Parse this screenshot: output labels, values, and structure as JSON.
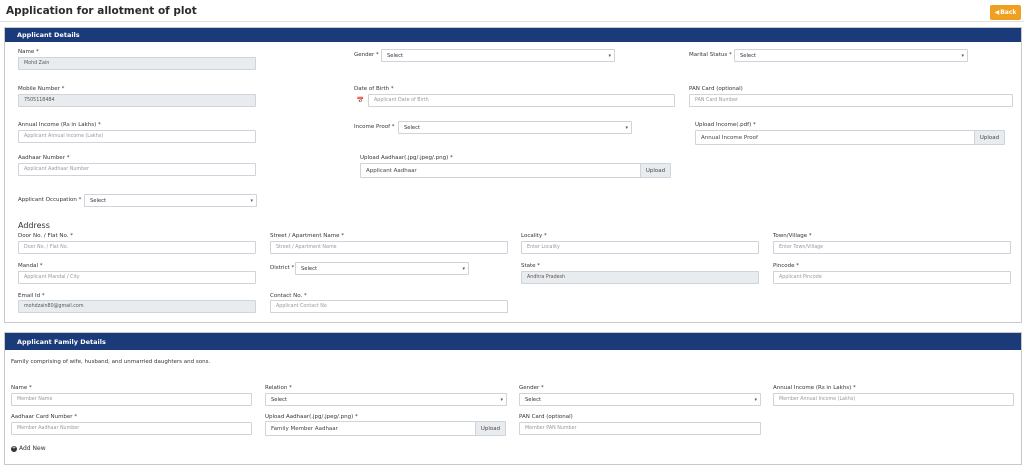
{
  "page": {
    "title": "Application for allotment of plot",
    "back_label": "Back"
  },
  "applicant": {
    "header": "Applicant Details",
    "name": {
      "label": "Name *",
      "value": "Mohd Zain"
    },
    "gender": {
      "label": "Gender *",
      "value": "Select"
    },
    "marital": {
      "label": "Marital Status *",
      "value": "Select"
    },
    "mobile": {
      "label": "Mobile Number *",
      "value": "7505118484"
    },
    "dob": {
      "label": "Date of Birth *",
      "placeholder": "Applicant Date of Birth"
    },
    "pan": {
      "label": "PAN Card (optional)",
      "placeholder": "PAN Card Number"
    },
    "income": {
      "label": "Annual Income (Rs in Lakhs) *",
      "placeholder": "Applicant Annual Income (Lakhs)"
    },
    "income_proof": {
      "label": "Income Proof *",
      "value": "Select"
    },
    "upload_income": {
      "label": "Upload Income(.pdf) *",
      "placeholder": "Annual Income Proof",
      "button": "Upload"
    },
    "aadhaar": {
      "label": "Aadhaar Number *",
      "placeholder": "Applicant Aadhaar Number"
    },
    "upload_aadhaar": {
      "label": "Upload Aadhaar(.jpg/.jpeg/.png) *",
      "placeholder": "Applicant Aadhaar",
      "button": "Upload"
    },
    "occupation": {
      "label": "Applicant Occupation *",
      "value": "Select"
    }
  },
  "address": {
    "title": "Address",
    "door": {
      "label": "Door No. / Flat No. *",
      "placeholder": "Door No. / Flat No."
    },
    "street": {
      "label": "Street / Apartment Name *",
      "placeholder": "Street / Apartment Name"
    },
    "locality": {
      "label": "Locality *",
      "placeholder": "Enter Locality"
    },
    "town": {
      "label": "Town/Village *",
      "placeholder": "Enter Town/Village"
    },
    "mandal": {
      "label": "Mandal *",
      "placeholder": "Applicant Mandal / City"
    },
    "district": {
      "label": "District *",
      "value": "Select"
    },
    "state": {
      "label": "State *",
      "value": "Andhra Pradesh"
    },
    "pincode": {
      "label": "Pincode *",
      "placeholder": "Applicant Pincode"
    },
    "email": {
      "label": "Email Id *",
      "value": "mohdzain80@gmail.com"
    },
    "contact": {
      "label": "Contact No. *",
      "placeholder": "Applicant Contact No"
    }
  },
  "family": {
    "header": "Applicant Family Details",
    "note": "Family comprising of wife, husband, and unmarried daughters and sons.",
    "name": {
      "label": "Name *",
      "placeholder": "Member Name"
    },
    "relation": {
      "label": "Relation *",
      "value": "Select"
    },
    "gender": {
      "label": "Gender *",
      "value": "Select"
    },
    "income": {
      "label": "Annual Income (Rs in Lakhs) *",
      "placeholder": "Member Annual Income (Lakhs)"
    },
    "aadhaar": {
      "label": "Aadhaar Card Number *",
      "placeholder": "Member Aadhaar Number"
    },
    "upload_aadhaar": {
      "label": "Upload Aadhaar(.jpg/.jpeg/.png) *",
      "placeholder": "Family Member Aadhaar",
      "button": "Upload"
    },
    "pan": {
      "label": "PAN Card (optional)",
      "placeholder": "Member PAN Number"
    },
    "add_new": "Add New"
  },
  "colors": {
    "header_bg": "#1b3a7a",
    "back_button": "#f0a020"
  }
}
